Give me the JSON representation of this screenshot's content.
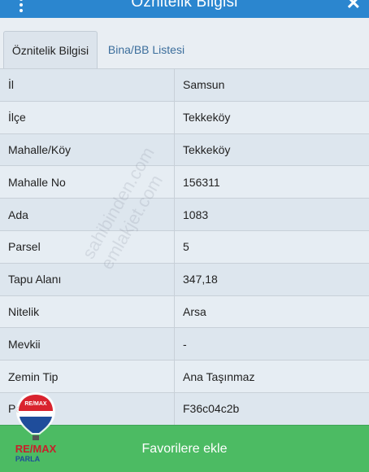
{
  "header": {
    "title": "Öznitelik Bilgisi",
    "close_glyph": "✕"
  },
  "tabs": [
    {
      "label": "Öznitelik Bilgisi",
      "active": true
    },
    {
      "label": "Bina/BB Listesi",
      "active": false
    }
  ],
  "rows": [
    {
      "label": "İl",
      "value": "Samsun"
    },
    {
      "label": "İlçe",
      "value": "Tekkeköy"
    },
    {
      "label": "Mahalle/Köy",
      "value": "Tekkeköy"
    },
    {
      "label": "Mahalle No",
      "value": "156311"
    },
    {
      "label": "Ada",
      "value": "1083"
    },
    {
      "label": "Parsel",
      "value": "5"
    },
    {
      "label": "Tapu Alanı",
      "value": "347,18"
    },
    {
      "label": "Nitelik",
      "value": "Arsa"
    },
    {
      "label": "Mevkii",
      "value": "-"
    },
    {
      "label": "Zemin Tip",
      "value": "Ana Taşınmaz"
    },
    {
      "label": "Parsel",
      "value": "F36c04c2b"
    }
  ],
  "favorite_button": {
    "label": "Favorilere ekle"
  },
  "watermark": {
    "line1": "sahibinden.com",
    "line2": "emlakjet.com"
  },
  "logo": {
    "brand": "RE/MAX",
    "sub": "PARLA"
  },
  "colors": {
    "header": "#2b86cf",
    "button": "#4cbb63",
    "row_bg": "#dde6ee",
    "border": "#c8d0d8"
  }
}
